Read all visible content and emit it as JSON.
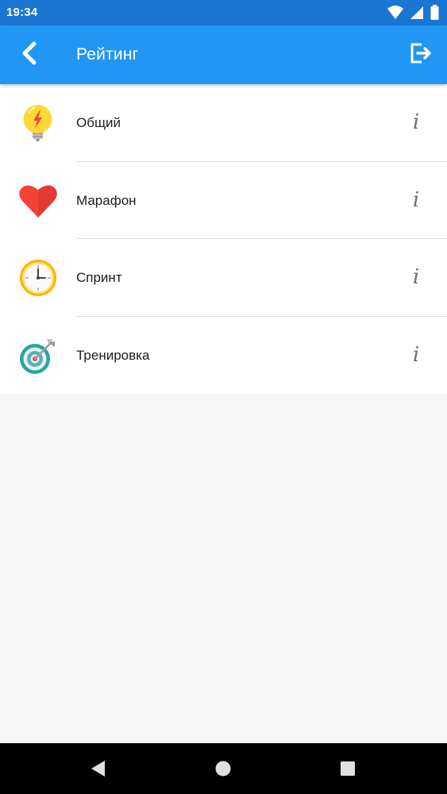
{
  "status_bar": {
    "time": "19:34",
    "icons": [
      "wifi-icon",
      "signal-icon",
      "battery-icon"
    ]
  },
  "app_bar": {
    "title": "Рейтинг",
    "back_icon": "chevron-left-icon",
    "action_icon": "logout-icon",
    "color": "#2196f3",
    "status_color": "#1976d2"
  },
  "ratings": {
    "items": [
      {
        "label": "Общий",
        "icon": "lightbulb-icon",
        "info": "i"
      },
      {
        "label": "Марафон",
        "icon": "heart-icon",
        "info": "i"
      },
      {
        "label": "Спринт",
        "icon": "clock-icon",
        "info": "i"
      },
      {
        "label": "Тренировка",
        "icon": "target-icon",
        "info": "i"
      }
    ]
  },
  "nav_bar": {
    "icons": [
      "nav-back-icon",
      "nav-home-icon",
      "nav-recents-icon"
    ]
  }
}
